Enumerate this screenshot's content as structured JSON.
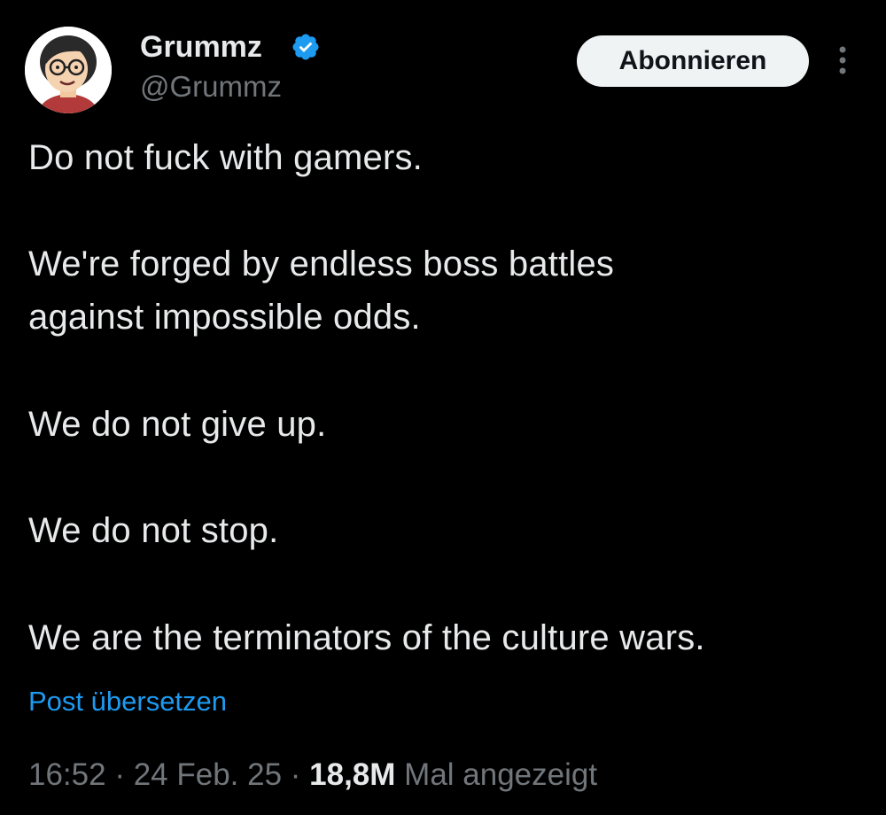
{
  "author": {
    "display_name": "Grummz",
    "handle": "@Grummz",
    "verified_icon": "verified-badge-icon",
    "avatar_icon": "cartoon-avatar"
  },
  "actions": {
    "follow_label": "Abonnieren",
    "more_icon": "more-vertical-icon"
  },
  "tweet": {
    "lines": [
      "Do not fuck with gamers.",
      "We're forged by endless boss battles",
      "against impossible odds.",
      "We do not give up.",
      "We do not stop.",
      "We are the terminators of the culture wars."
    ],
    "translate_label": "Post übersetzen"
  },
  "meta": {
    "time": "16:52",
    "sep1": " · ",
    "date": "24 Feb. 25",
    "sep2": " · ",
    "views_count": "18,8M",
    "views_label": " Mal angezeigt"
  },
  "colors": {
    "background": "#000000",
    "text": "#e7e9ea",
    "secondary_text": "#71767b",
    "link": "#1d9bf0",
    "verified": "#1d9bf0",
    "button_bg": "#eff3f4",
    "button_text": "#0f1419"
  }
}
